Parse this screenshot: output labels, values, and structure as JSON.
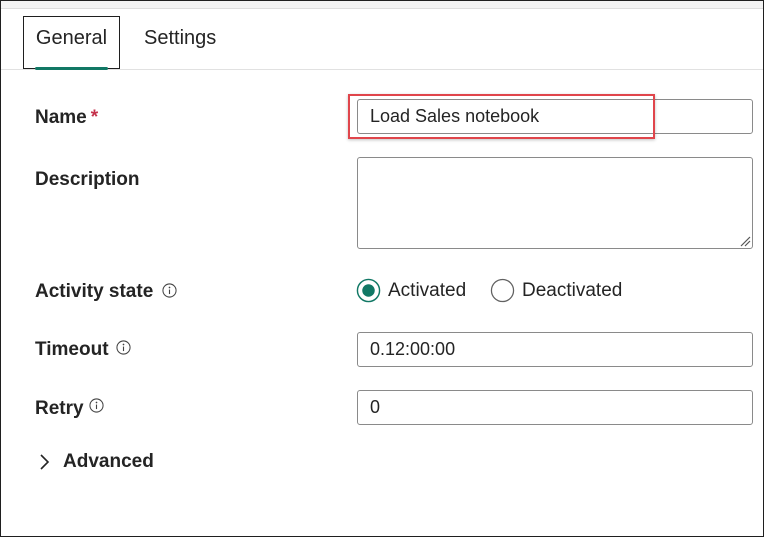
{
  "tabs": [
    {
      "label": "General",
      "active": true
    },
    {
      "label": "Settings",
      "active": false
    }
  ],
  "form": {
    "name": {
      "label": "Name",
      "required_mark": "*",
      "value": "Load Sales notebook"
    },
    "description": {
      "label": "Description",
      "value": ""
    },
    "activity_state": {
      "label": "Activity state",
      "options": [
        "Activated",
        "Deactivated"
      ],
      "selected": "Activated"
    },
    "timeout": {
      "label": "Timeout",
      "value": "0.12:00:00"
    },
    "retry": {
      "label": "Retry",
      "value": "0"
    },
    "advanced": {
      "label": "Advanced"
    }
  },
  "colors": {
    "accent": "#117865",
    "required": "#c4314b",
    "highlight": "#e0454b"
  },
  "icons": {
    "info": "info-icon",
    "chevron": "chevron-right-icon"
  }
}
